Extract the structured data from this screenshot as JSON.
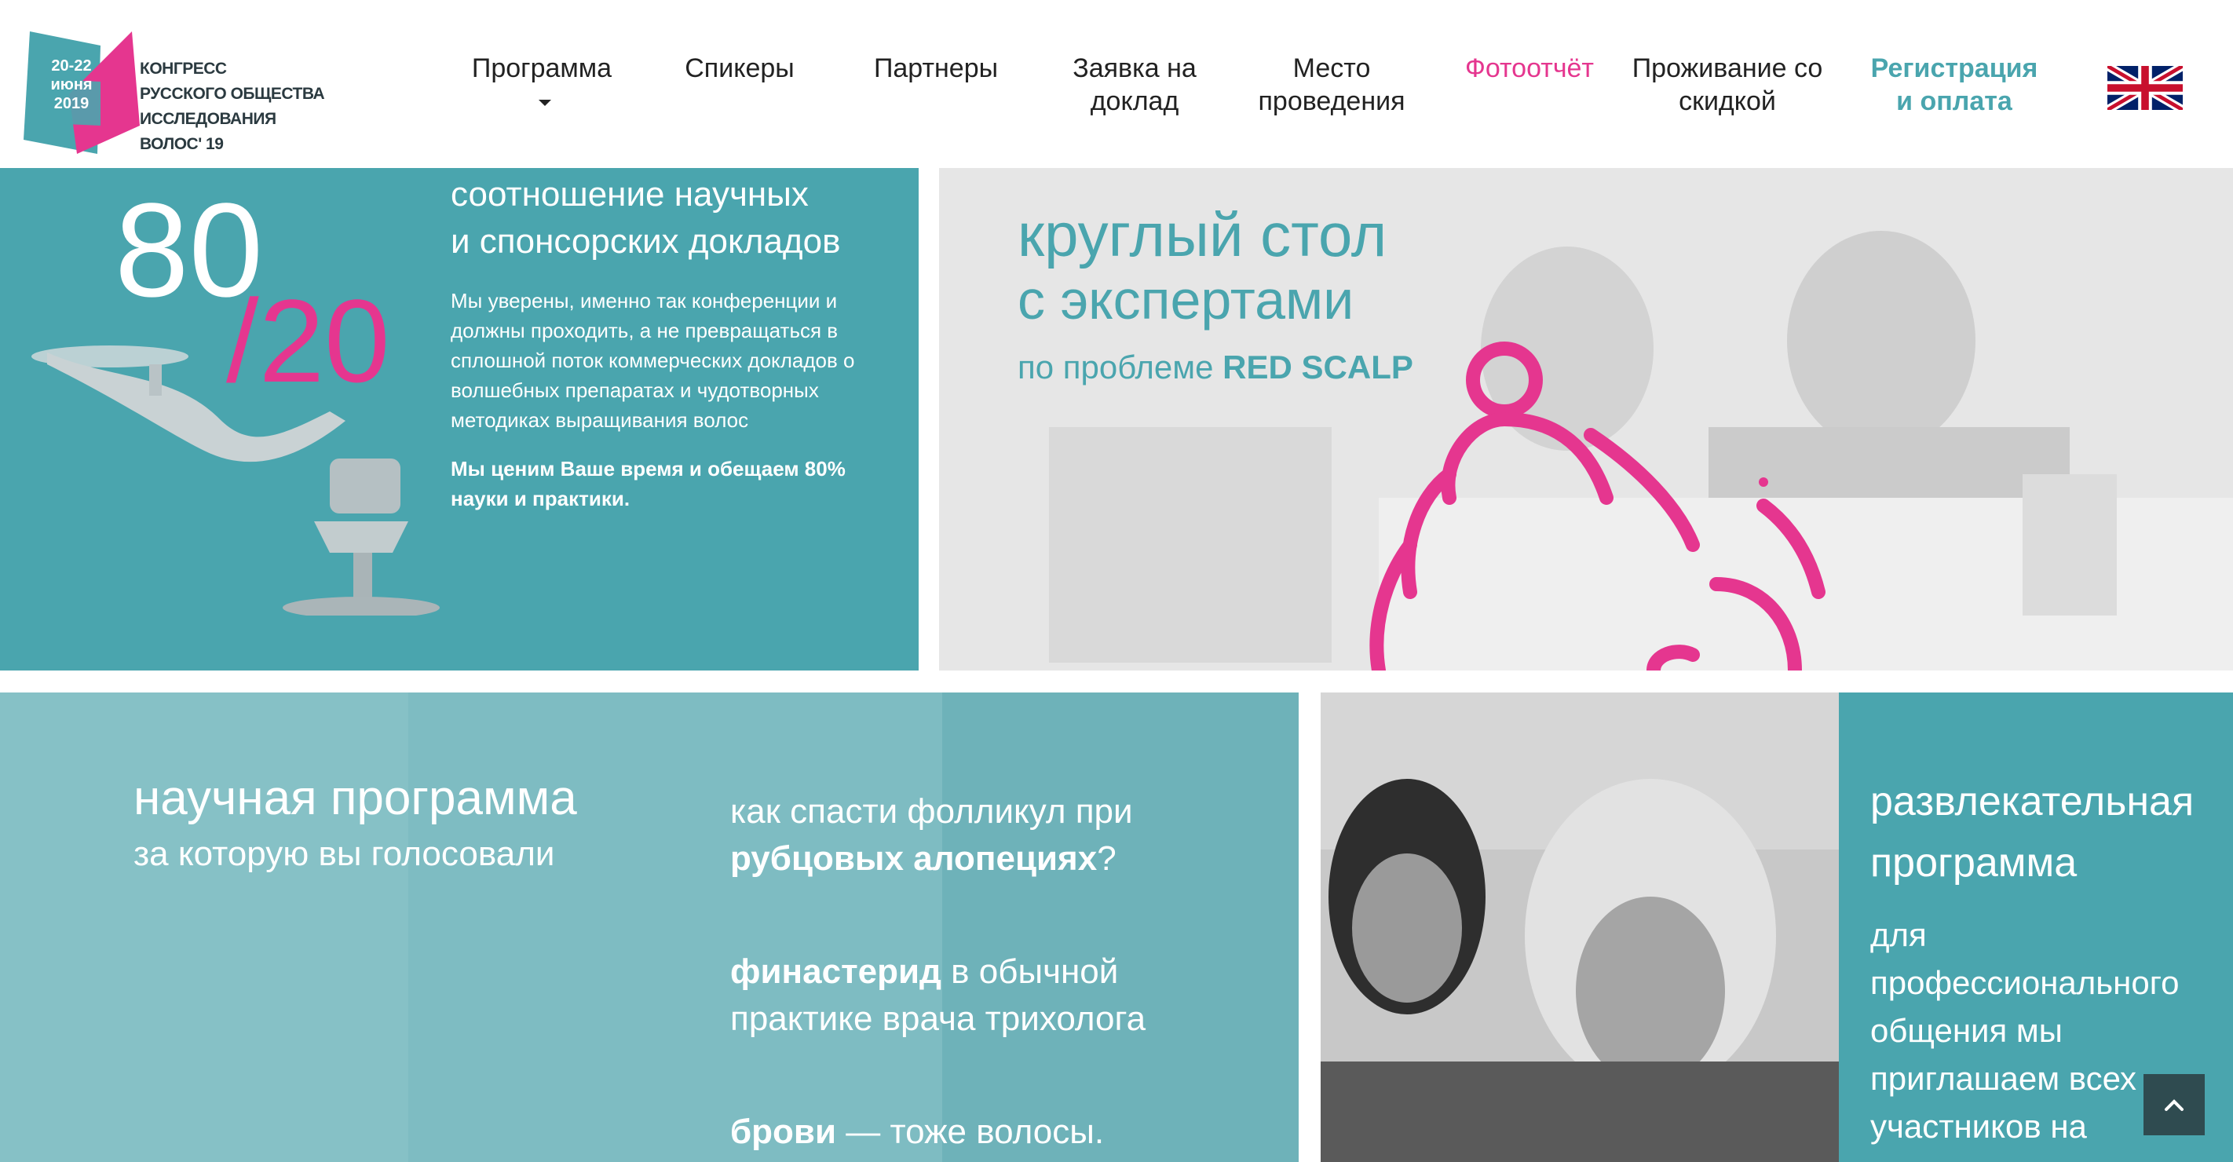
{
  "logo": {
    "date_line1": "20-22",
    "date_line2": "июня",
    "date_line3": "2019",
    "text_line1": "КОНГРЕСС",
    "text_line2": "РУССКОГО ОБЩЕСТВА",
    "text_line3": "ИССЛЕДОВАНИЯ ВОЛОС' 19",
    "colors": {
      "teal": "#4aa5ae",
      "pink": "#e5368f",
      "dark": "#2b3a40"
    }
  },
  "nav": {
    "items": [
      {
        "line1": "Программа",
        "line2": ""
      },
      {
        "line1": "Спикеры",
        "line2": ""
      },
      {
        "line1": "Партнеры",
        "line2": ""
      },
      {
        "line1": "Заявка на",
        "line2": "доклад"
      },
      {
        "line1": "Место",
        "line2": "проведения"
      },
      {
        "line1": "Фотоотчёт",
        "line2": ""
      },
      {
        "line1": "Проживание со",
        "line2": "скидкой"
      },
      {
        "line1": "Регистрация",
        "line2": "и оплата"
      }
    ],
    "active_color": "#e5368f",
    "register_color": "#4aa5ae",
    "language_icon": "uk-flag-icon"
  },
  "ratio_panel": {
    "big_number": "80",
    "small_number": "/20",
    "title_line1": "соотношение научных",
    "title_line2": "и спонсорских докладов",
    "body": "Мы уверены, именно так конференции и должны проходить, а не превращаться в сплошной поток коммерческих докладов о волшебных препаратах и чудотворных методиках выращивания волос",
    "bold": "Мы ценим Ваше время и обещаем 80% науки и практики."
  },
  "round_table": {
    "title_line1": "круглый стол",
    "title_line2": "с экспертами",
    "subtitle_prefix": "по проблеме ",
    "subtitle_bold": "RED SCALP",
    "icon": "people-circle-icon"
  },
  "science_program": {
    "title": "научная программа",
    "subtitle": "за которую вы голосовали",
    "q1_line1": "как спасти фолликул при",
    "q1_bold": "рубцовых алопециях",
    "q1_suffix": "?",
    "q2_bold": "финастерид",
    "q2_rest": " в обычной",
    "q2_line2": "практике врача трихолога",
    "q3_bold": "брови",
    "q3_rest": " — тоже волосы."
  },
  "entertainment": {
    "title_line1": "развлекательная",
    "title_line2": "программа",
    "body_lines": [
      "для",
      "профессионального",
      "общения мы",
      "приглашаем всех",
      "участников на"
    ]
  },
  "scroll_top": {
    "icon": "chevron-up-icon"
  }
}
